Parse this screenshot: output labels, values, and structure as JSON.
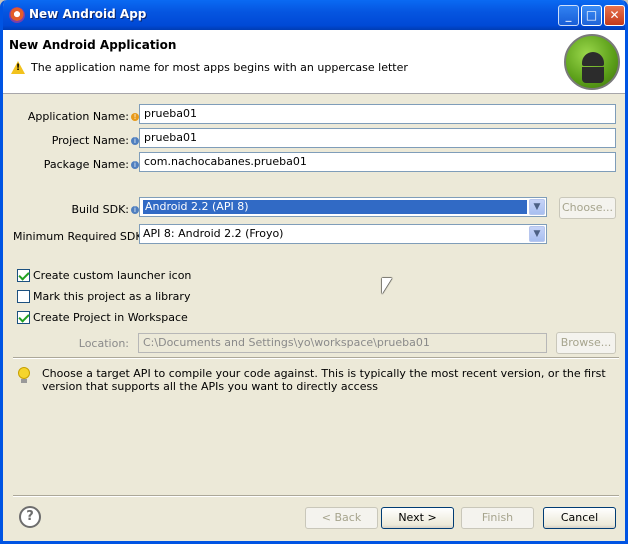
{
  "window": {
    "title": "New Android App"
  },
  "header": {
    "title": "New Android Application",
    "message": "The application name for most apps begins with an uppercase letter"
  },
  "form": {
    "application_name": {
      "label": "Application Name:",
      "value": "prueba01"
    },
    "project_name": {
      "label": "Project Name:",
      "value": "prueba01"
    },
    "package_name": {
      "label": "Package Name:",
      "value": "com.nachocabanes.prueba01"
    },
    "build_sdk": {
      "label": "Build SDK:",
      "value": "Android 2.2 (API 8)",
      "choose_label": "Choose..."
    },
    "min_sdk": {
      "label": "Minimum Required SDK:",
      "value": "API 8: Android 2.2 (Froyo)"
    },
    "checkboxes": [
      {
        "label": "Create custom launcher icon",
        "checked": true
      },
      {
        "label": "Mark this project as a library",
        "checked": false
      },
      {
        "label": "Create Project in Workspace",
        "checked": true
      }
    ],
    "location": {
      "label": "Location:",
      "value": "C:\\Documents and Settings\\yo\\workspace\\prueba01",
      "browse_label": "Browse..."
    }
  },
  "hint": "Choose a target API to compile your code against. This is typically the most recent version, or the first version that supports all the APIs you want to directly access",
  "footer": {
    "back_label": "< Back",
    "next_label": "Next >",
    "finish_label": "Finish",
    "cancel_label": "Cancel"
  }
}
